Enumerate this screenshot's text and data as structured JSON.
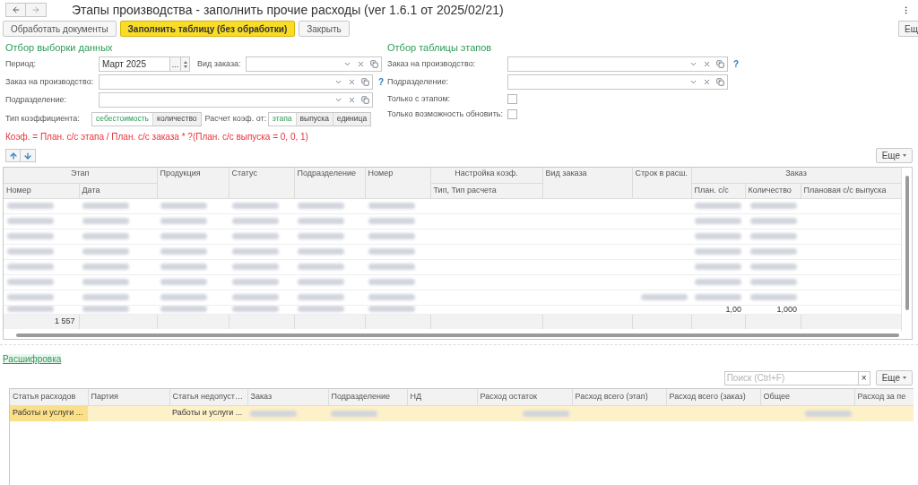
{
  "title": "Этапы производства - заполнить прочие расходы (ver 1.6.1 от 2025/02/21)",
  "toolbar": [
    {
      "label": "Обработать документы",
      "kind": "default"
    },
    {
      "label": "Заполнить таблицу (без обработки)",
      "kind": "primary"
    },
    {
      "label": "Закрыть",
      "kind": "default"
    }
  ],
  "more_top": "Ещ",
  "left_filter": {
    "title": "Отбор выборки данных",
    "period": {
      "label": "Период:",
      "value": "Март 2025",
      "choose": "..."
    },
    "order_kind": {
      "label": "Вид заказа:"
    },
    "order": {
      "label": "Заказ на производство:",
      "help": "?"
    },
    "division": {
      "label": "Подразделение:"
    },
    "coef_type": {
      "label": "Тип коэффициента:",
      "options": [
        {
          "label": "себестоимость",
          "selected": true
        },
        {
          "label": "количество",
          "selected": false
        }
      ]
    },
    "calc_from": {
      "label": "Расчет коэф. от:",
      "options": [
        {
          "label": "этапа",
          "selected": true
        },
        {
          "label": "выпуска",
          "selected": false
        },
        {
          "label": "единица",
          "selected": false
        }
      ]
    },
    "formula": "Коэф. = План. с/с этапа / План. с/с заказа * ?(План. с/с выпуска = 0, 0, 1)"
  },
  "right_filter": {
    "title": "Отбор таблицы этапов",
    "order": {
      "label": "Заказ на производство:",
      "help": "?"
    },
    "division": {
      "label": "Подразделение:"
    },
    "only_stage": {
      "label": "Только с этапом:",
      "checked": false
    },
    "only_update": {
      "label": "Только возможность обновить:",
      "checked": false
    }
  },
  "stages": {
    "more": "Еще",
    "columns": [
      {
        "label": "Этап",
        "colspan": 2,
        "children": [
          {
            "label": "Номер"
          },
          {
            "label": "Дата"
          }
        ]
      },
      {
        "label": "Продукция"
      },
      {
        "label": "Статус"
      },
      {
        "label": "Подразделение"
      },
      {
        "label": "Номер"
      },
      {
        "label": "Настройка коэф.",
        "children": [
          {
            "label": "Тип, Тип расчета"
          }
        ]
      },
      {
        "label": "Вид заказа"
      },
      {
        "label": "Строк в расш."
      },
      {
        "label": "Заказ",
        "colspan": 3,
        "children": [
          {
            "label": "План. с/с"
          },
          {
            "label": "Количество"
          },
          {
            "label": "Плановая с/с выпуска"
          }
        ]
      }
    ],
    "rows": [
      {
        "cells": [
          {
            "kind": "blur"
          },
          {
            "kind": "blur"
          },
          {
            "kind": "blur"
          },
          {
            "kind": "blur"
          },
          {
            "kind": "blur"
          },
          {
            "kind": "blur"
          },
          {
            "kind": "empty"
          },
          {
            "kind": "empty"
          },
          {
            "kind": "empty"
          },
          {
            "kind": "blur"
          },
          {
            "kind": "blur"
          },
          {
            "kind": "empty"
          }
        ]
      },
      {
        "cells": [
          {
            "kind": "blur"
          },
          {
            "kind": "blur"
          },
          {
            "kind": "blur"
          },
          {
            "kind": "blur"
          },
          {
            "kind": "blur"
          },
          {
            "kind": "blur"
          },
          {
            "kind": "empty"
          },
          {
            "kind": "empty"
          },
          {
            "kind": "empty"
          },
          {
            "kind": "blur"
          },
          {
            "kind": "blur"
          },
          {
            "kind": "empty"
          }
        ]
      },
      {
        "cells": [
          {
            "kind": "blur"
          },
          {
            "kind": "blur"
          },
          {
            "kind": "blur"
          },
          {
            "kind": "blur"
          },
          {
            "kind": "blur"
          },
          {
            "kind": "blur"
          },
          {
            "kind": "empty"
          },
          {
            "kind": "empty"
          },
          {
            "kind": "empty"
          },
          {
            "kind": "blur"
          },
          {
            "kind": "blur"
          },
          {
            "kind": "empty"
          }
        ]
      },
      {
        "cells": [
          {
            "kind": "blur"
          },
          {
            "kind": "blur"
          },
          {
            "kind": "blur"
          },
          {
            "kind": "blur"
          },
          {
            "kind": "blur"
          },
          {
            "kind": "blur"
          },
          {
            "kind": "empty"
          },
          {
            "kind": "empty"
          },
          {
            "kind": "empty"
          },
          {
            "kind": "blur"
          },
          {
            "kind": "blur"
          },
          {
            "kind": "empty"
          }
        ]
      },
      {
        "cells": [
          {
            "kind": "blur"
          },
          {
            "kind": "blur"
          },
          {
            "kind": "blur"
          },
          {
            "kind": "blur"
          },
          {
            "kind": "blur"
          },
          {
            "kind": "blur"
          },
          {
            "kind": "empty"
          },
          {
            "kind": "empty"
          },
          {
            "kind": "empty"
          },
          {
            "kind": "blur"
          },
          {
            "kind": "blur"
          },
          {
            "kind": "empty"
          }
        ]
      },
      {
        "cells": [
          {
            "kind": "blur"
          },
          {
            "kind": "blur"
          },
          {
            "kind": "blur"
          },
          {
            "kind": "blur"
          },
          {
            "kind": "blur"
          },
          {
            "kind": "blur"
          },
          {
            "kind": "empty"
          },
          {
            "kind": "empty"
          },
          {
            "kind": "empty"
          },
          {
            "kind": "blur"
          },
          {
            "kind": "blur"
          },
          {
            "kind": "empty"
          }
        ]
      },
      {
        "cells": [
          {
            "kind": "blur"
          },
          {
            "kind": "blur"
          },
          {
            "kind": "blur"
          },
          {
            "kind": "blur"
          },
          {
            "kind": "blur"
          },
          {
            "kind": "blur"
          },
          {
            "kind": "empty"
          },
          {
            "kind": "empty"
          },
          {
            "kind": "blur"
          },
          {
            "kind": "blur"
          },
          {
            "kind": "blur"
          },
          {
            "kind": "empty"
          }
        ]
      },
      {
        "cells": [
          {
            "kind": "blur"
          },
          {
            "kind": "blur"
          },
          {
            "kind": "blur"
          },
          {
            "kind": "blur"
          },
          {
            "kind": "blur"
          },
          {
            "kind": "blur"
          },
          {
            "kind": "empty"
          },
          {
            "kind": "empty"
          },
          {
            "kind": "empty"
          },
          {
            "kind": "text",
            "text": "1,00"
          },
          {
            "kind": "text",
            "text": "1,000"
          },
          {
            "kind": "empty"
          }
        ]
      }
    ],
    "total": "1 557"
  },
  "link": "Расшифровка",
  "details": {
    "search": {
      "placeholder": "Поиск (Ctrl+F)",
      "clear": "×"
    },
    "more": "Еще",
    "columns": [
      "Статья расходов",
      "Партия",
      "Статья недопуст…",
      "Заказ",
      "Подразделение",
      "НД",
      "Расход остаток",
      "Расход всего (этап)",
      "Расход всего (заказ)",
      "Общее",
      "Расход за пе"
    ],
    "rows": [
      {
        "selected": true,
        "cells": [
          {
            "kind": "text",
            "text": "Работы и услуги ..."
          },
          {
            "kind": "empty"
          },
          {
            "kind": "text",
            "text": "Работы и услуги ..."
          },
          {
            "kind": "blur"
          },
          {
            "kind": "blur"
          },
          {
            "kind": "empty"
          },
          {
            "kind": "blur"
          },
          {
            "kind": "empty"
          },
          {
            "kind": "empty"
          },
          {
            "kind": "blur"
          },
          {
            "kind": "empty"
          }
        ]
      }
    ]
  }
}
